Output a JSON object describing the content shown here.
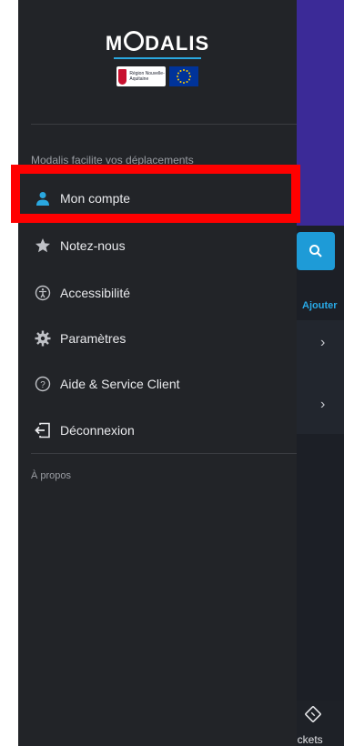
{
  "background_app": {
    "add_link": "Ajouter",
    "chevron": "›",
    "bottom_tab_label": "ickets",
    "colors": {
      "header": "#3b2a97",
      "search_button": "#1e9bd7",
      "link": "#28a9e6"
    }
  },
  "drawer": {
    "logo": {
      "brand_name_prefix": "M",
      "brand_name_suffix": "DALIS",
      "partner_region_text": "Région Nouvelle-Aquitaine"
    },
    "caption": "Modalis facilite vos déplacements",
    "menu": [
      {
        "label": "Mon compte",
        "icon": "person-icon"
      },
      {
        "label": "Notez-nous",
        "icon": "star-icon"
      },
      {
        "label": "Accessibilité",
        "icon": "accessibility-icon"
      },
      {
        "label": "Paramètres",
        "icon": "gear-icon"
      },
      {
        "label": "Aide & Service Client",
        "icon": "help-icon"
      },
      {
        "label": "Déconnexion",
        "icon": "logout-icon"
      }
    ],
    "about": "À propos"
  },
  "colors": {
    "drawer_bg": "#222428",
    "highlight": "#ff0000",
    "account_icon": "#2aa8e0"
  }
}
